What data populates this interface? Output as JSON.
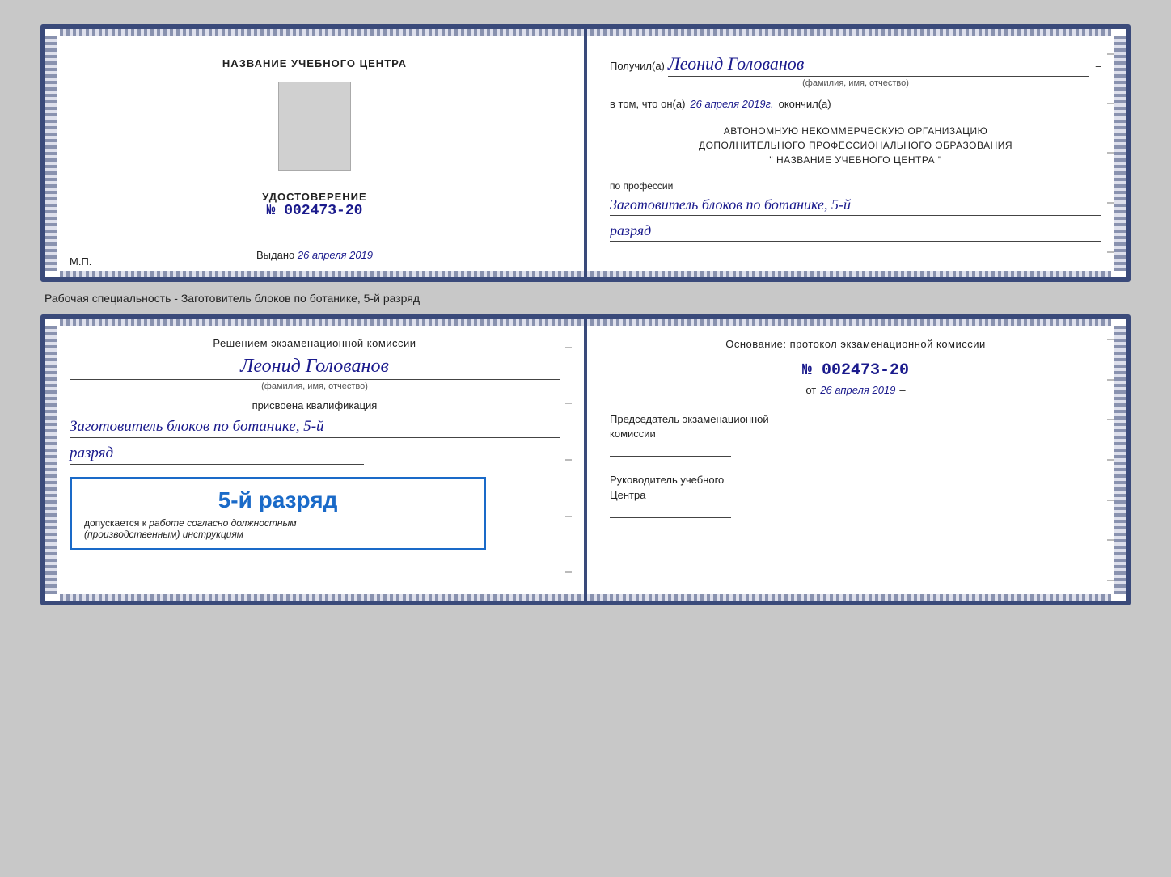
{
  "top_card": {
    "left": {
      "title": "НАЗВАНИЕ УЧЕБНОГО ЦЕНТРА",
      "udostoverenie_label": "УДОСТОВЕРЕНИЕ",
      "number_prefix": "№",
      "number": "002473-20",
      "vydano_label": "Выдано",
      "vydano_date": "26 апреля 2019",
      "mp_label": "М.П."
    },
    "right": {
      "poluchil_label": "Получил(а)",
      "recipient_name": "Леонид Голованов",
      "fio_hint": "(фамилия, имя, отчество)",
      "vtom_label": "в том, что он(а)",
      "vtom_date": "26 апреля 2019г.",
      "okonchil_label": "окончил(а)",
      "org_line1": "АВТОНОМНУЮ НЕКОММЕРЧЕСКУЮ ОРГАНИЗАЦИЮ",
      "org_line2": "ДОПОЛНИТЕЛЬНОГО ПРОФЕССИОНАЛЬНОГО ОБРАЗОВАНИЯ",
      "org_line3": "\"  НАЗВАНИЕ УЧЕБНОГО ЦЕНТРА  \"",
      "po_professii_label": "по профессии",
      "professiya": "Заготовитель блоков по ботанике, 5-й",
      "razryad": "разряд"
    }
  },
  "subtitle": "Рабочая специальность - Заготовитель блоков по ботанике, 5-й разряд",
  "bottom_card": {
    "left": {
      "resheniem_label": "Решением экзаменационной комиссии",
      "name": "Леонид Голованов",
      "fio_hint": "(фамилия, имя, отчество)",
      "prisvoena_label": "присвоена квалификация",
      "kvali": "Заготовитель блоков по ботанике, 5-й",
      "razryad": "разряд",
      "stamp_text": "5-й разряд",
      "dopuskaetsya_prefix": "допускается к",
      "dopuskaetsya_suffix": "работе согласно должностным",
      "instruktsiya": "(производственным) инструкциям"
    },
    "right": {
      "osnovanie_label": "Основание: протокол экзаменационной комиссии",
      "number_prefix": "№",
      "number": "002473-20",
      "ot_prefix": "от",
      "ot_date": "26 апреля 2019",
      "chairman_label": "Председатель экзаменационной",
      "chairman_label2": "комиссии",
      "rukovo_label": "Руководитель учебного",
      "tsentra_label": "Центра"
    }
  }
}
